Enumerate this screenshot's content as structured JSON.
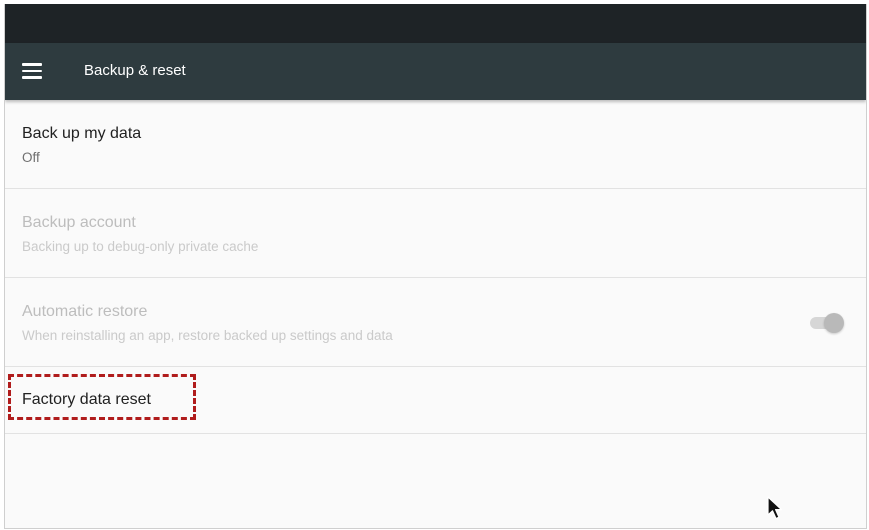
{
  "app_bar": {
    "title": "Backup & reset",
    "menu_icon": "hamburger-menu-icon"
  },
  "settings": [
    {
      "title": "Back up my data",
      "subtitle": "Off",
      "enabled": true
    },
    {
      "title": "Backup account",
      "subtitle": "Backing up to debug-only private cache",
      "enabled": false
    },
    {
      "title": "Automatic restore",
      "subtitle": "When reinstalling an app, restore backed up settings and data",
      "enabled": false,
      "toggle_on": true
    },
    {
      "title": "Factory data reset",
      "enabled": true,
      "highlighted": true
    }
  ],
  "colors": {
    "status_bar": "#1e2326",
    "app_bar": "#2e3b3f",
    "highlight": "#b01c1c"
  },
  "cursor_icon": "mouse-pointer-icon"
}
